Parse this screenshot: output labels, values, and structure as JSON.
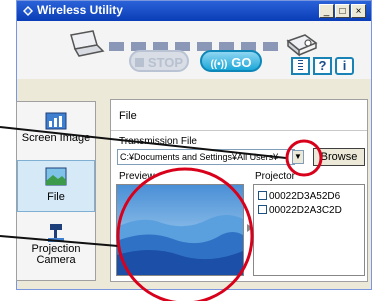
{
  "window": {
    "title": "Wireless Utility",
    "title_buttons": [
      "_",
      "□",
      "×"
    ]
  },
  "controls": {
    "stop_label": "STOP",
    "go_label": "GO",
    "help_label": "?",
    "info_label": "i"
  },
  "sidebar": {
    "items": [
      {
        "label": "Screen Image"
      },
      {
        "label": "File",
        "selected": true
      },
      {
        "label": "Projection Camera"
      }
    ]
  },
  "content": {
    "section_title": "File",
    "transmission_label": "Transmission File",
    "path_value": "C:¥Documents and Settings¥All Users¥",
    "browse_label": "Browse",
    "preview_label": "Preview",
    "projector_label": "Projector",
    "projectors": [
      "00022D3A52D6",
      "00022D2A3C2D"
    ]
  },
  "colors": {
    "titlebar": "#0a3db7",
    "accent": "#1ba8d8",
    "callout": "#d8001a"
  }
}
